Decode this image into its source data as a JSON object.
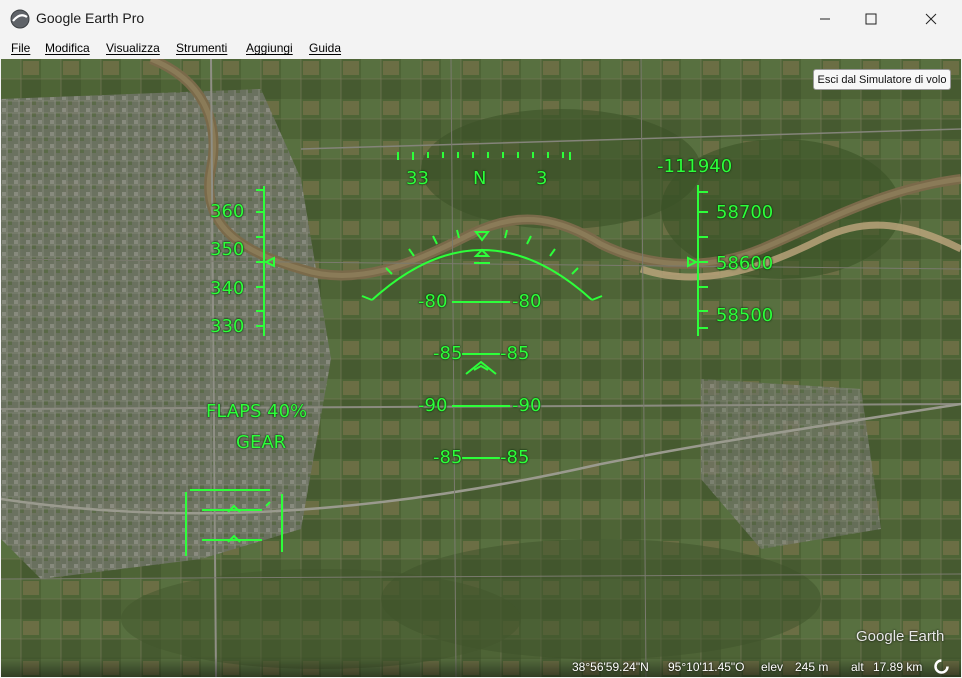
{
  "window": {
    "title": "Google Earth Pro"
  },
  "menu": [
    "File",
    "Modifica",
    "Visualizza",
    "Strumenti",
    "Aggiungi",
    "Guida"
  ],
  "exit_button": "Esci dal Simulatore di volo",
  "hud": {
    "heading": {
      "left": "33",
      "center": "N",
      "right": "3"
    },
    "speed": {
      "labels": [
        "360",
        "350",
        "340",
        "330"
      ]
    },
    "altitude": {
      "top": "-111940",
      "labels": [
        "58700",
        "58600",
        "58500"
      ]
    },
    "pitch": [
      {
        "left": "-80",
        "right": "-80"
      },
      {
        "left": "-85",
        "right": "-85"
      },
      {
        "left": "-90",
        "right": "-90"
      },
      {
        "left": "-85",
        "right": "-85"
      }
    ],
    "flaps": "FLAPS 40%",
    "gear": "GEAR"
  },
  "status": {
    "lat": "38°56'59.24\"N",
    "lon": "95°10'11.45\"O",
    "elev_label": "elev",
    "elev_value": "245 m",
    "alt_label": "alt",
    "alt_value": "17.89 km"
  },
  "logo": "Google Earth",
  "colors": {
    "hud": "#2dff3a",
    "titlebar": "#f3f3f3"
  }
}
